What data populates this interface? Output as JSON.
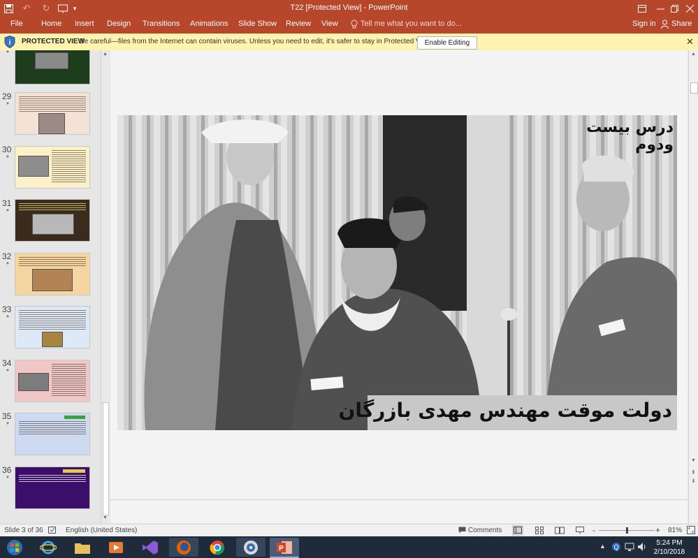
{
  "window": {
    "title": "T22 [Protected View] - PowerPoint"
  },
  "ribbon": {
    "tabs": [
      "File",
      "Home",
      "Insert",
      "Design",
      "Transitions",
      "Animations",
      "Slide Show",
      "Review",
      "View"
    ],
    "tell_me": "Tell me what you want to do...",
    "sign_in": "Sign in",
    "share": "Share"
  },
  "protected_view": {
    "title": "PROTECTED VIEW",
    "message": "Be careful—files from the Internet can contain viruses. Unless you need to edit, it's safer to stay in Protected View.",
    "enable_button": "Enable Editing",
    "close": "✕"
  },
  "thumbnails": [
    {
      "number": "29",
      "star": "*"
    },
    {
      "number": "30",
      "star": "*"
    },
    {
      "number": "31",
      "star": "*"
    },
    {
      "number": "32",
      "star": "*"
    },
    {
      "number": "33",
      "star": "*"
    },
    {
      "number": "34",
      "star": "*"
    },
    {
      "number": "35",
      "star": "*"
    },
    {
      "number": "36",
      "star": "*"
    }
  ],
  "top_partial_thumb_star": "*",
  "slide": {
    "title": "درس بیست ودوم",
    "subtitle": "دولت موقت مهندس مهدی بازرگان"
  },
  "status": {
    "slide_indicator": "Slide 3 of 36",
    "language": "English (United States)",
    "comments": "Comments",
    "zoom_minus": "-",
    "zoom_plus": "+",
    "zoom_level": "81%",
    "zoom_fraction": 0.5
  },
  "taskbar": {
    "time": "5:24 PM",
    "date": "2/10/2018"
  }
}
